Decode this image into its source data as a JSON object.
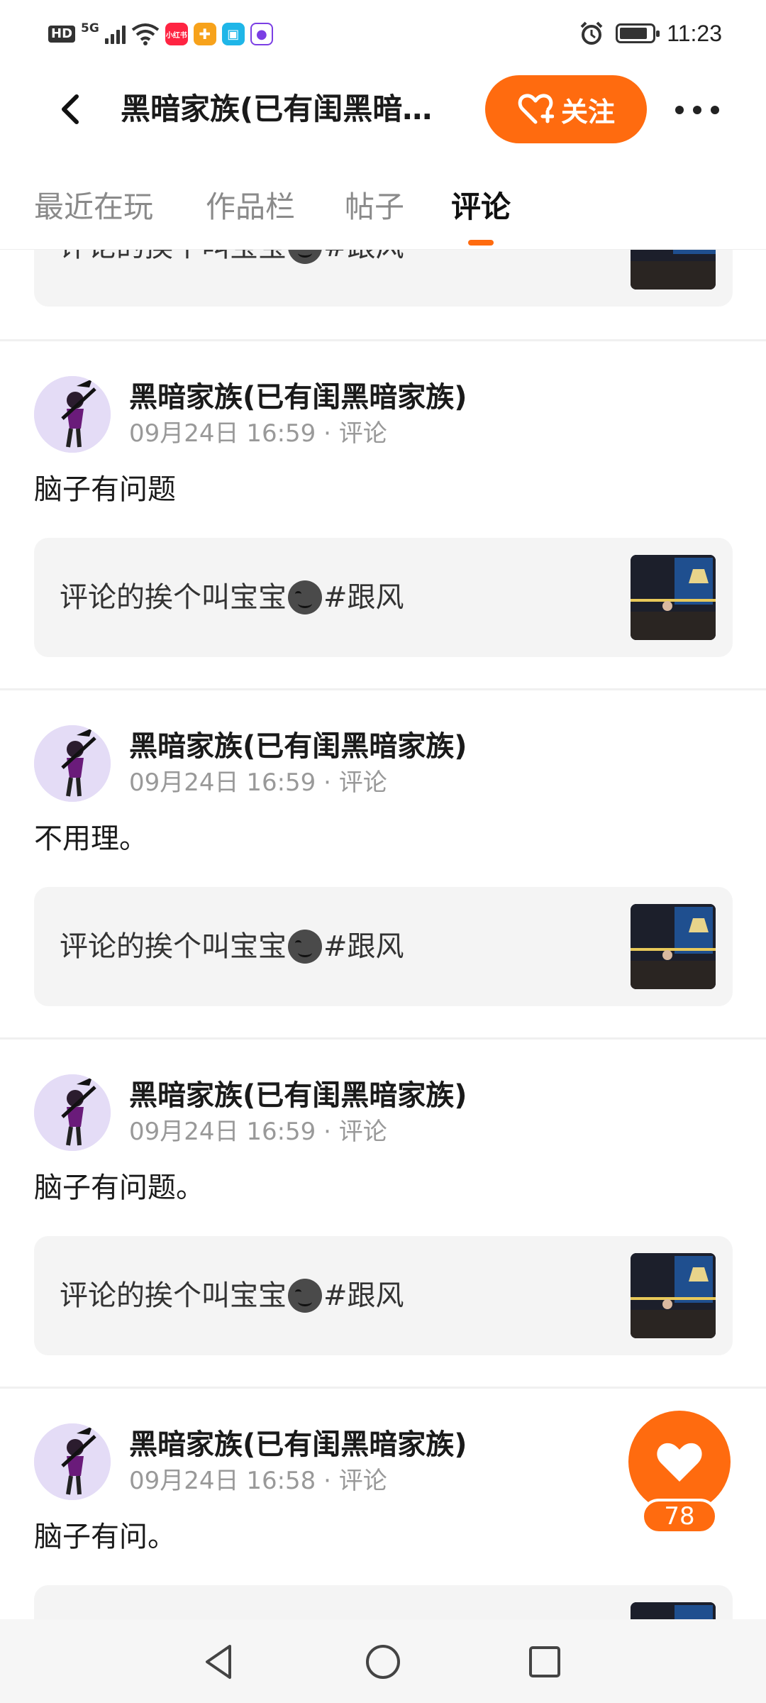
{
  "status_bar": {
    "hd": "HD",
    "network": "5G",
    "app_icons": [
      {
        "name": "xiaohongshu-icon",
        "label": "小红书",
        "color": "#ff2442"
      },
      {
        "name": "app-icon-2",
        "label": "",
        "color": "#f7a21b"
      },
      {
        "name": "app-icon-3",
        "label": "",
        "color": "#1fb6e8"
      },
      {
        "name": "app-icon-4",
        "label": "",
        "color": "#7b3fe4"
      }
    ],
    "time": "11:23"
  },
  "header": {
    "title": "黑暗家族(已有闺黑暗…",
    "follow_label": "关注"
  },
  "tabs": [
    {
      "label": "最近在玩",
      "active": false
    },
    {
      "label": "作品栏",
      "active": false
    },
    {
      "label": "帖子",
      "active": false
    },
    {
      "label": "评论",
      "active": true
    }
  ],
  "partial_top": {
    "quote_text": "评论的挨个叫宝宝",
    "quote_tag": "#跟风"
  },
  "posts": [
    {
      "username": "黑暗家族(已有闺黑暗家族)",
      "meta": "09月24日 16:59 · 评论",
      "text": "脑子有问题",
      "quote_text": "评论的挨个叫宝宝",
      "quote_tag": "#跟风"
    },
    {
      "username": "黑暗家族(已有闺黑暗家族)",
      "meta": "09月24日 16:59 · 评论",
      "text": "不用理。",
      "quote_text": "评论的挨个叫宝宝",
      "quote_tag": "#跟风"
    },
    {
      "username": "黑暗家族(已有闺黑暗家族)",
      "meta": "09月24日 16:59 · 评论",
      "text": "脑子有问题。",
      "quote_text": "评论的挨个叫宝宝",
      "quote_tag": "#跟风"
    },
    {
      "username": "黑暗家族(已有闺黑暗家族)",
      "meta": "09月24日 16:58 · 评论",
      "text": "脑子有问。",
      "quote_text": "",
      "quote_tag": ""
    }
  ],
  "like_fab": {
    "count": "78"
  },
  "colors": {
    "accent": "#ff6b0f",
    "quote_bg": "#f4f4f4",
    "meta": "#999999"
  }
}
